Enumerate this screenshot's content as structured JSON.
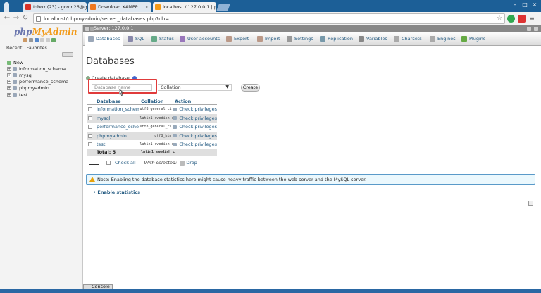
{
  "browser": {
    "tabs": [
      {
        "label": "Inbox (23) - govin26@g",
        "icon": "gmail-icon",
        "color": "#d93025"
      },
      {
        "label": "Download XAMPP",
        "icon": "xampp-icon",
        "color": "#f0781e"
      },
      {
        "label": "localhost / 127.0.0.1 | ph",
        "icon": "phpmyadmin-icon",
        "color": "#f29a18"
      }
    ],
    "url": "localhost/phpmyadmin/server_databases.php?db="
  },
  "sidebar": {
    "logo_a": "php",
    "logo_b": "MyAdmin",
    "tab_recent": "Recent",
    "tab_favorites": "Favorites",
    "new_label": "New",
    "databases": [
      "information_schema",
      "mysql",
      "performance_schema",
      "phpmyadmin",
      "test"
    ]
  },
  "server": {
    "label": "Server: 127.0.0.1"
  },
  "menu": [
    "Databases",
    "SQL",
    "Status",
    "User accounts",
    "Export",
    "Import",
    "Settings",
    "Replication",
    "Variables",
    "Charsets",
    "Engines",
    "Plugins"
  ],
  "page": {
    "title": "Databases",
    "create_label": "Create database",
    "dbname_placeholder": "Database name",
    "collation_value": "Collation",
    "create_button": "Create"
  },
  "table": {
    "headers": {
      "database": "Database",
      "collation": "Collation",
      "action": "Action"
    },
    "rows": [
      {
        "name": "information_schema",
        "collation": "utf8_general_ci",
        "action": "Check privileges"
      },
      {
        "name": "mysql",
        "collation": "latin1_swedish_ci",
        "action": "Check privileges"
      },
      {
        "name": "performance_schema",
        "collation": "utf8_general_ci",
        "action": "Check privileges"
      },
      {
        "name": "phpmyadmin",
        "collation": "utf8_bin",
        "action": "Check privileges"
      },
      {
        "name": "test",
        "collation": "latin1_swedish_ci",
        "action": "Check privileges"
      }
    ],
    "total_label": "Total: 5",
    "total_collation": "latin1_swedish_ci"
  },
  "bulk": {
    "check_all": "Check all",
    "with_selected": "With selected:",
    "drop": "Drop"
  },
  "note": "Note: Enabling the database statistics here might cause heavy traffic between the web server and the MySQL server.",
  "enable_stats": "Enable statistics",
  "console": "Console",
  "colors": {
    "titlebar": "#1c5f97",
    "link": "#235a81",
    "note_border": "#5a9ac9",
    "highlight": "#e03b3b"
  }
}
